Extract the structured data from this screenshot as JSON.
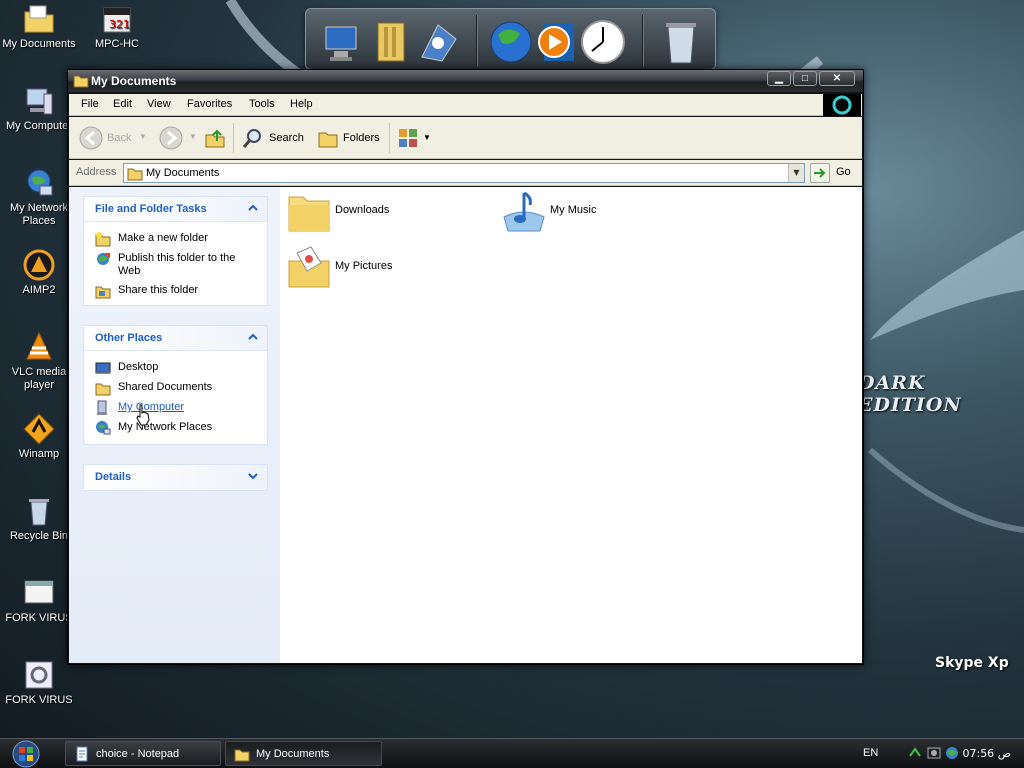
{
  "desktop": {
    "icons": [
      {
        "label": "My Documents",
        "icon": "my-documents-icon"
      },
      {
        "label": "MPC-HC",
        "icon": "mpc-hc-icon"
      },
      {
        "label": "My Computer",
        "icon": "my-computer-icon"
      },
      {
        "label": "My Network Places",
        "icon": "network-places-icon"
      },
      {
        "label": "AIMP2",
        "icon": "aimp2-icon"
      },
      {
        "label": "VLC media player",
        "icon": "vlc-icon"
      },
      {
        "label": "Winamp",
        "icon": "winamp-icon"
      },
      {
        "label": "Recycle Bin",
        "icon": "recycle-bin-icon"
      },
      {
        "label": "FORK VIRUS",
        "icon": "window-icon"
      },
      {
        "label": "FORK VIRUS",
        "icon": "settings-icon"
      }
    ],
    "branding": {
      "edition": "DARK EDITION",
      "product": "Skype Xp"
    }
  },
  "window": {
    "title": "My Documents",
    "controls": {
      "minimize": "▁",
      "maximize": "□",
      "close": "✕"
    },
    "menu": [
      "File",
      "Edit",
      "View",
      "Favorites",
      "Tools",
      "Help"
    ],
    "toolbar": {
      "back": "Back",
      "search": "Search",
      "folders": "Folders"
    },
    "address": {
      "label": "Address",
      "value": "My Documents",
      "go": "Go"
    },
    "taskpane": {
      "file_tasks": {
        "title": "File and Folder Tasks",
        "items": [
          "Make a new folder",
          "Publish this folder to the Web",
          "Share this folder"
        ]
      },
      "other_places": {
        "title": "Other Places",
        "items": [
          "Desktop",
          "Shared Documents",
          "My Computer",
          "My Network Places"
        ]
      },
      "details": {
        "title": "Details"
      }
    },
    "files": [
      {
        "name": "Downloads",
        "icon": "folder-icon"
      },
      {
        "name": "My Music",
        "icon": "music-folder-icon"
      },
      {
        "name": "My Pictures",
        "icon": "pictures-folder-icon"
      }
    ]
  },
  "taskbar": {
    "buttons": [
      "choice - Notepad",
      "My Documents"
    ],
    "language": "EN",
    "clock": "07:56 ص"
  },
  "colors": {
    "link": "#215dc6",
    "menu_bg": "#f1efe2",
    "taskpane_bg": "#e4ecf8"
  }
}
